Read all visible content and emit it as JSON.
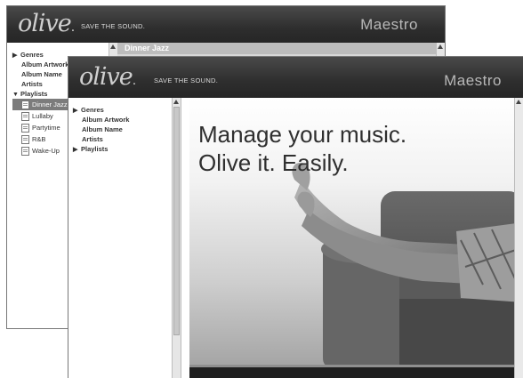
{
  "back_window": {
    "logo": "olive",
    "tagline": "SAVE THE SOUND.",
    "app_title": "Maestro",
    "tree": {
      "genres": "Genres",
      "album_artwork": "Album Artwork",
      "album_name": "Album Name",
      "artists": "Artists",
      "playlists": "Playlists",
      "playlist_items": [
        "Dinner Jazz",
        "Lullaby",
        "Partytime",
        "R&B",
        "Wake-Up"
      ],
      "selected_playlist": "Dinner Jazz"
    },
    "header_text": "Dinner Jazz"
  },
  "front_window": {
    "logo": "olive",
    "tagline": "SAVE THE SOUND.",
    "app_title": "Maestro",
    "tree": {
      "genres": "Genres",
      "album_artwork": "Album Artwork",
      "album_name": "Album Name",
      "artists": "Artists",
      "playlists": "Playlists"
    },
    "hero_line1": "Manage your music.",
    "hero_line2": "Olive it. Easily."
  },
  "colors": {
    "topbar": "#2e2e2e",
    "selection": "#7c7c7c"
  },
  "icons": [
    "triangle-right-icon",
    "triangle-down-icon",
    "playlist-doc-icon",
    "scroll-up-arrow-icon"
  ]
}
